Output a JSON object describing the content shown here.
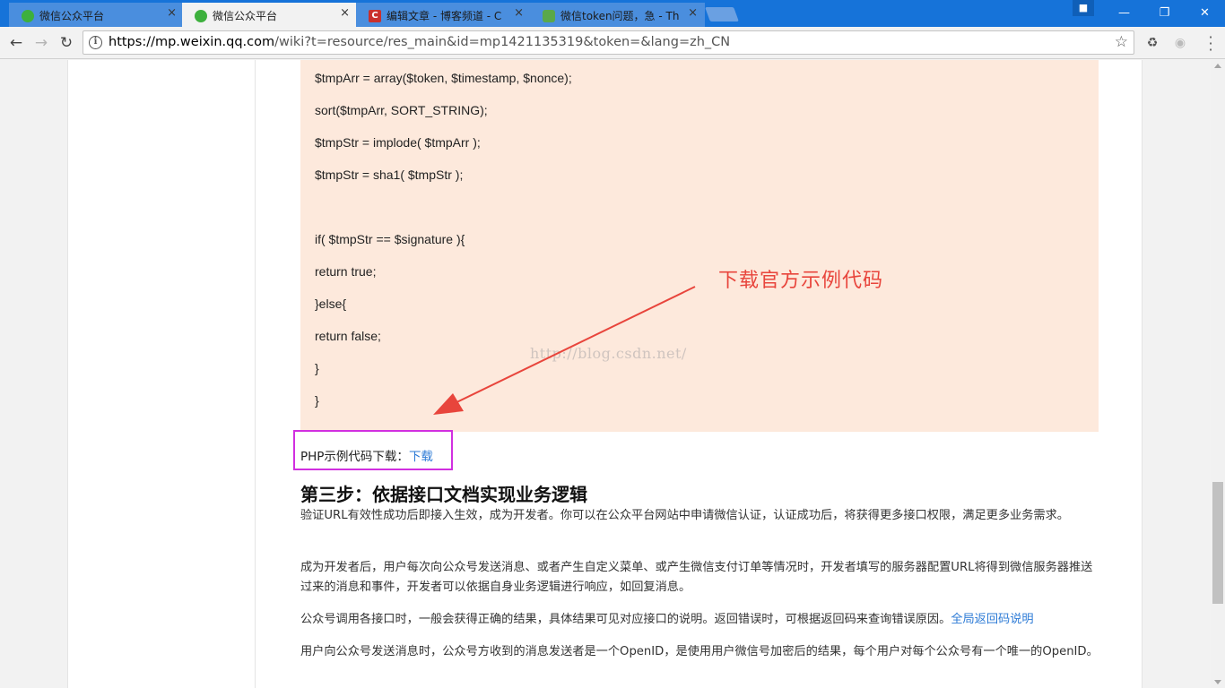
{
  "browser": {
    "tabs": [
      {
        "title": "微信公众平台",
        "icon": "wechat-icon",
        "active": false
      },
      {
        "title": "微信公众平台",
        "icon": "wechat-icon",
        "active": true
      },
      {
        "title": "编辑文章 - 博客频道 - C",
        "icon": "csdn-icon",
        "active": false
      },
      {
        "title": "微信token问题，急 - Th",
        "icon": "thinkphp-icon",
        "active": false
      }
    ],
    "tab_close": "×",
    "address_host": "https://mp.weixin.qq.com",
    "address_path": "/wiki?t=resource/res_main&id=mp1421135319&token=&lang=zh_CN",
    "colors": {
      "titlebar": "#1673d9",
      "accent_link": "#2d7bd6",
      "annotation": "#e8453c",
      "highlight_box": "#d12fe0",
      "code_bg": "#fde9dc"
    }
  },
  "page": {
    "code_lines": [
      "$tmpArr = array($token, $timestamp, $nonce);",
      "sort($tmpArr, SORT_STRING);",
      "$tmpStr = implode( $tmpArr );",
      "$tmpStr = sha1( $tmpStr );",
      "",
      "if( $tmpStr == $signature ){",
      "return true;",
      "}else{",
      "return false;",
      "}",
      "}"
    ],
    "watermark": "http://blog.csdn.net/",
    "annotation": "下载官方示例代码",
    "download_label": "PHP示例代码下载：",
    "download_link": "下载",
    "section_title": "第三步：依据接口文档实现业务逻辑",
    "para1": "验证URL有效性成功后即接入生效，成为开发者。你可以在公众平台网站中申请微信认证，认证成功后，将获得更多接口权限，满足更多业务需求。",
    "para2": "成为开发者后，用户每次向公众号发送消息、或者产生自定义菜单、或产生微信支付订单等情况时，开发者填写的服务器配置URL将得到微信服务器推送过来的消息和事件，开发者可以依据自身业务逻辑进行响应，如回复消息。",
    "para3_text": "公众号调用各接口时，一般会获得正确的结果，具体结果可见对应接口的说明。返回错误时，可根据返回码来查询错误原因。",
    "para3_link": "全局返回码说明",
    "para4": "用户向公众号发送消息时，公众号方收到的消息发送者是一个OpenID，是使用用户微信号加密后的结果，每个用户对每个公众号有一个唯一的OpenID。"
  }
}
